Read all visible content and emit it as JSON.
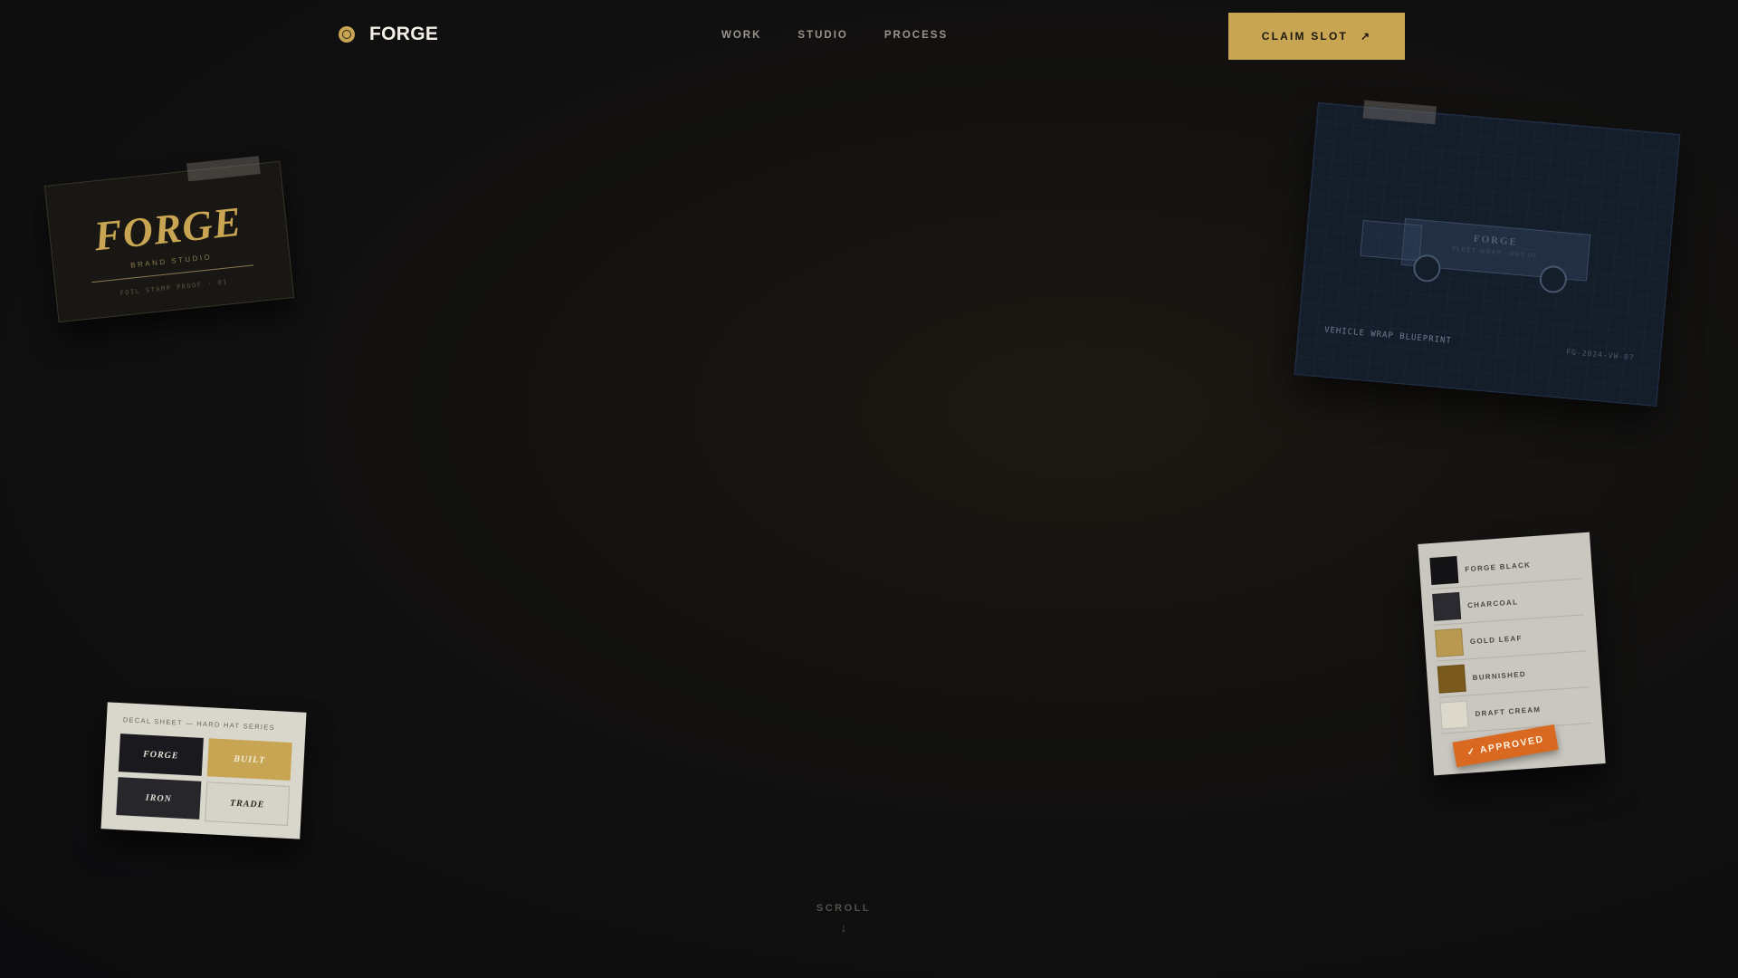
{
  "header": {
    "brand": "FORGE",
    "nav": [
      "WORK",
      "STUDIO",
      "PROCESS"
    ],
    "cta_label": "CLAIM SLOT",
    "cta_icon": "arrow-up-right-icon"
  },
  "cards": {
    "business_card": {
      "title": "FORGE",
      "subtitle": "BRAND STUDIO",
      "meta": "FOIL STAMP PROOF · 01"
    },
    "blueprint": {
      "truck_brand": "FORGE",
      "truck_sub": "FLEET WRAP · REV 07",
      "label": "VEHICLE WRAP BLUEPRINT",
      "code": "FG-2024-VW-07"
    },
    "decal_sheet": {
      "header": "DECAL SHEET — HARD HAT SERIES",
      "decals": [
        {
          "label": "FORGE",
          "bg": "#1a1a1e",
          "fg": "#e8e4da"
        },
        {
          "label": "BUILT",
          "bg": "#c8a552",
          "fg": "#f3ecd8"
        },
        {
          "label": "IRON",
          "bg": "#26262b",
          "fg": "#e0ddd4"
        },
        {
          "label": "TRADE",
          "bg": "#d6d3c9",
          "fg": "#2a2822"
        }
      ]
    },
    "swatches": {
      "items": [
        {
          "name": "FORGE BLACK",
          "color": "#141416"
        },
        {
          "name": "CHARCOAL",
          "color": "#2a2a30"
        },
        {
          "name": "GOLD LEAF",
          "color": "#b8994f"
        },
        {
          "name": "BURNISHED",
          "color": "#7a5a1c"
        },
        {
          "name": "DRAFT CREAM",
          "color": "#dcd8cc"
        }
      ],
      "stamp": "✓ APPROVED",
      "stamp_color": "#d96920"
    }
  },
  "scroll": {
    "label": "SCROLL",
    "icon": "arrow-down-icon"
  },
  "colors": {
    "accent": "#c8a552",
    "background": "#111012"
  }
}
